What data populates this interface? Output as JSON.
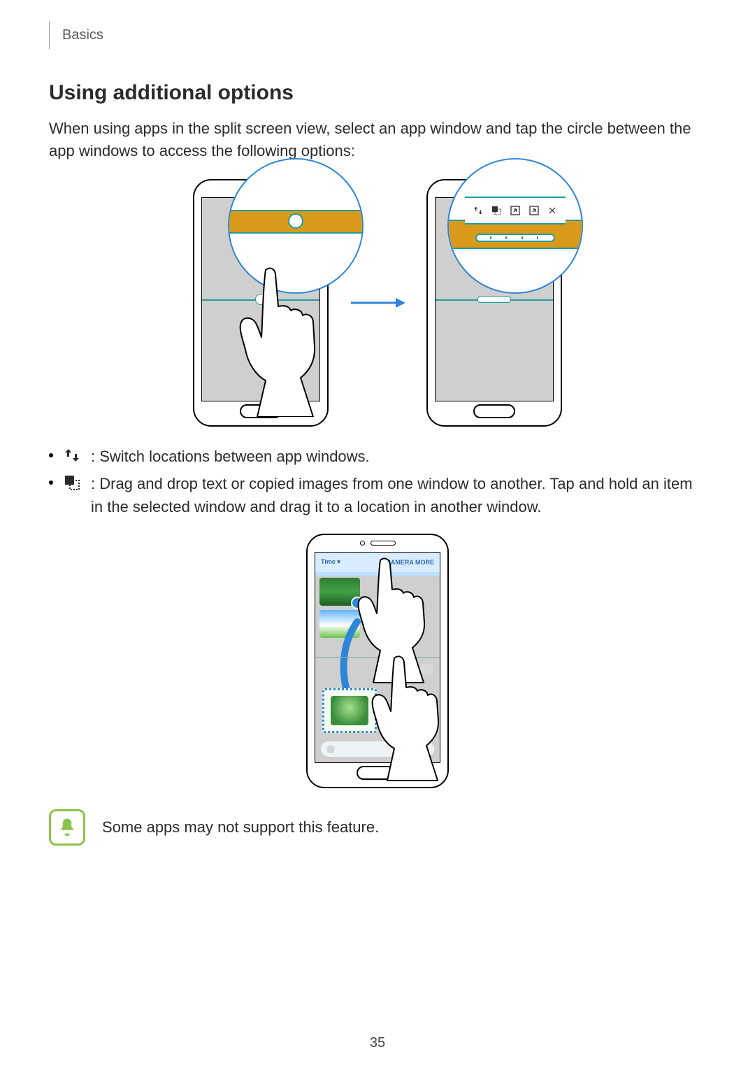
{
  "header": {
    "breadcrumb": "Basics"
  },
  "section": {
    "title": "Using additional options",
    "lead": "When using apps in the split screen view, select an app window and tap the circle between the app windows to access the following options:"
  },
  "options": [
    {
      "icon": "swap-icon",
      "text": ": Switch locations between app windows."
    },
    {
      "icon": "drag-copy-icon",
      "text": ": Drag and drop text or copied images from one window to another. Tap and hold an item in the selected window and drag it to a location in another window."
    }
  ],
  "option_toolbar": {
    "items": [
      "swap-icon",
      "drag-copy-icon",
      "maximize-pane-icon",
      "open-popup-icon",
      "close-icon"
    ]
  },
  "gallery_header": {
    "left": "Time ▾",
    "right": "CAMERA   MORE"
  },
  "note": {
    "text": "Some apps may not support this feature."
  },
  "page_number": "35"
}
